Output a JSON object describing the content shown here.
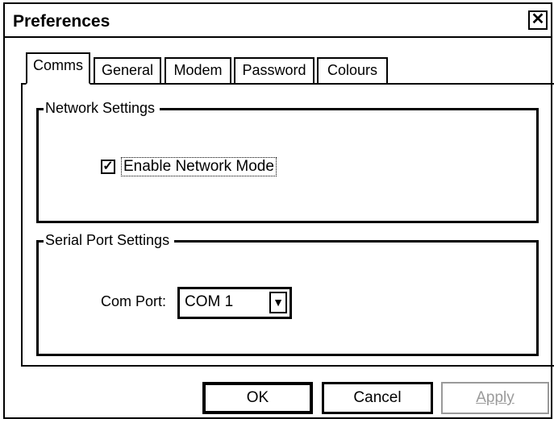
{
  "window": {
    "title": "Preferences",
    "close_glyph": "✕"
  },
  "tabs": [
    {
      "label": "Comms",
      "active": true
    },
    {
      "label": "General",
      "active": false
    },
    {
      "label": "Modem",
      "active": false
    },
    {
      "label": "Password",
      "active": false
    },
    {
      "label": "Colours",
      "active": false
    }
  ],
  "network_settings": {
    "group_label": "Network Settings",
    "enable_network_mode_label": "Enable Network Mode",
    "enable_network_mode_checked": true,
    "check_glyph": "✓"
  },
  "serial_port_settings": {
    "group_label": "Serial Port Settings",
    "com_port_label": "Com Port:",
    "com_port_value": "COM 1",
    "dropdown_glyph": "▼"
  },
  "buttons": {
    "ok": "OK",
    "cancel": "Cancel",
    "apply": "Apply"
  }
}
